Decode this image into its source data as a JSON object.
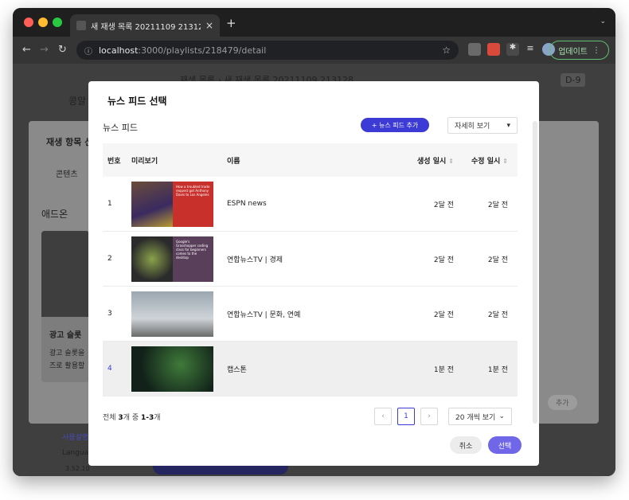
{
  "browser": {
    "tab_title": "새 재생 목록 20211109 213128 | ...",
    "url_host": "localhost",
    "url_rest": ":3000/playlists/218479/detail",
    "update_label": "업데이트",
    "new_tab_symbol": "+",
    "close_symbol": "×",
    "accent_green": "#5fbf73"
  },
  "background": {
    "breadcrumb_prefix": "재생 목록  ›",
    "breadcrumb_title": "새 재생 목록 20211109 213128",
    "badge": "D-9",
    "left_button": "콩알",
    "panel_title": "재생 항목 선",
    "panel_tab": "콘텐츠",
    "addon_label": "애드온",
    "card_title": "광고 슬롯",
    "card_desc1": "광고 슬롯을",
    "card_desc2": "즈로 활용할",
    "add_label": "추가",
    "footer1": "사용설명",
    "footer2": "Langua",
    "footer3": "3.52.10"
  },
  "modal": {
    "title": "뉴스 피드 선택",
    "section_title": "뉴스 피드",
    "add_button": "+ 뉴스 피드 추가",
    "view_select": "자세히 보기",
    "headers": {
      "num": "번호",
      "preview": "미리보기",
      "name": "이름",
      "created": "생성 일시",
      "updated": "수정 일시"
    },
    "rows": [
      {
        "num": "1",
        "name": "ESPN news",
        "created": "2달 전",
        "updated": "2달 전",
        "thumb_text": "How a troubled trade request got Anthony Davis to Los Angeles"
      },
      {
        "num": "2",
        "name": "연합뉴스TV | 경제",
        "created": "2달 전",
        "updated": "2달 전",
        "thumb_text": "Google's Grasshopper coding class for beginners comes to the desktop"
      },
      {
        "num": "3",
        "name": "연합뉴스TV | 문화, 연예",
        "created": "2달 전",
        "updated": "2달 전",
        "thumb_text": ""
      },
      {
        "num": "4",
        "name": "캡스톤",
        "created": "1분 전",
        "updated": "1분 전",
        "thumb_text": ""
      }
    ],
    "total_prefix": "전체 ",
    "total_count": "3",
    "total_mid": "개 중 ",
    "total_range": "1-3",
    "total_suffix": "개",
    "current_page": "1",
    "per_page": "20 개씩 보기",
    "cancel": "취소",
    "select": "선택",
    "accent": "#3d3bd6"
  }
}
